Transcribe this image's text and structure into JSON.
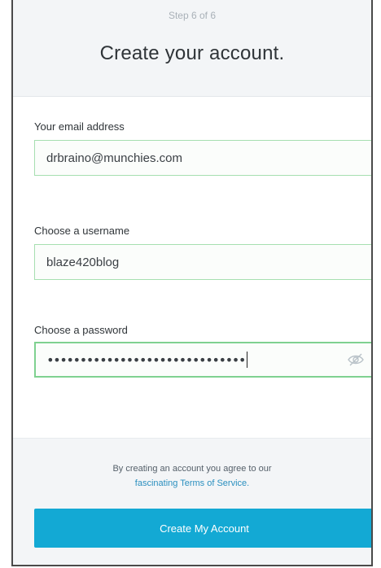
{
  "header": {
    "step": "Step 6 of 6",
    "title": "Create your account."
  },
  "form": {
    "email": {
      "label": "Your email address",
      "value": "drbraino@munchies.com"
    },
    "username": {
      "label": "Choose a username",
      "value": "blaze420blog"
    },
    "password": {
      "label": "Choose a password",
      "value_masked": "••••••••••••••••••••••••••••••",
      "toggle_icon": "eye-slash-icon"
    }
  },
  "footer": {
    "terms_prefix": "By creating an account you agree to our",
    "terms_link": "fascinating Terms of Service.",
    "submit_label": "Create My Account"
  },
  "colors": {
    "accent": "#13a9d4",
    "field_border": "#a6dfb0",
    "header_bg": "#f3f5f7"
  }
}
